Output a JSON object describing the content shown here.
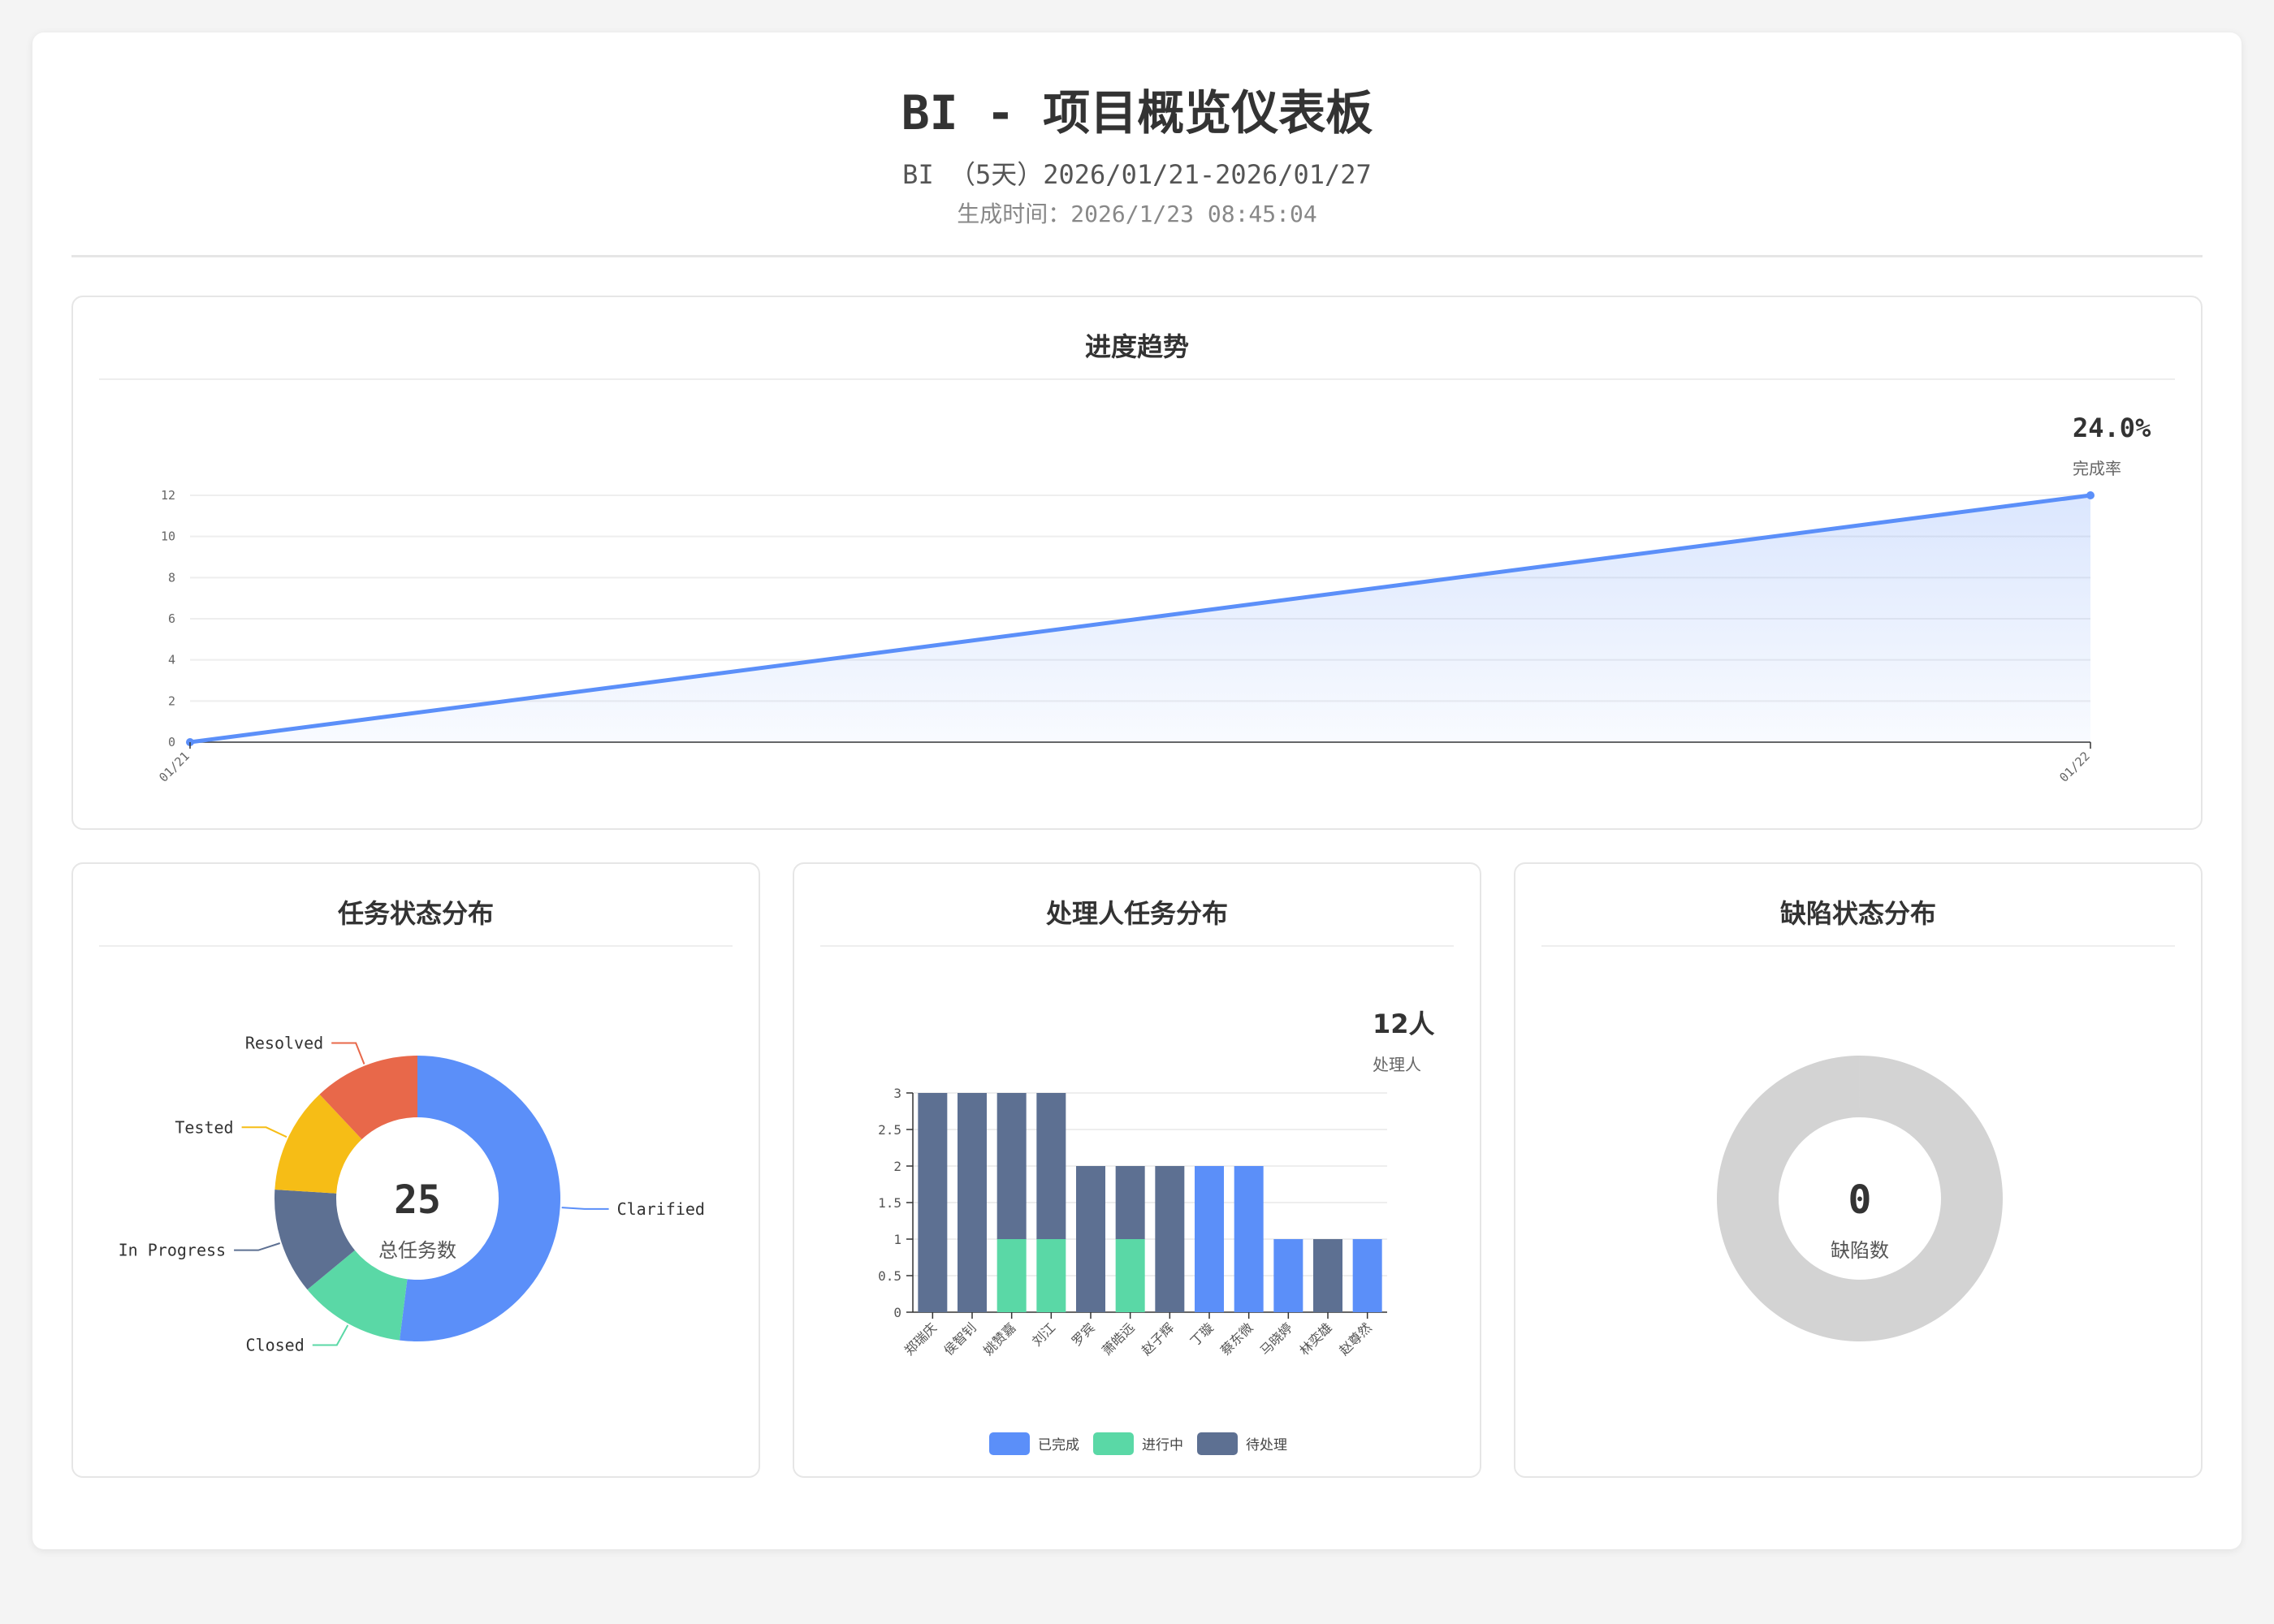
{
  "header": {
    "title": "BI - 项目概览仪表板",
    "subtitle": "BI （5天）2026/01/21-2026/01/27",
    "generated": "生成时间：2026/1/23 08:45:04"
  },
  "progress": {
    "card_title": "进度趋势",
    "kpi_value": "24.0%",
    "kpi_label": "完成率",
    "chart_data": {
      "type": "area",
      "x": [
        "01/21",
        "01/22"
      ],
      "series": [
        {
          "values": [
            0,
            12
          ]
        }
      ],
      "yticks": [
        0,
        2,
        4,
        6,
        8,
        10,
        12
      ],
      "ylim": [
        0,
        12
      ],
      "grid": true,
      "color": "#5b8ff9"
    }
  },
  "task_status": {
    "card_title": "任务状态分布",
    "center_value": "25",
    "center_label": "总任务数",
    "chart_data": {
      "type": "pie",
      "categories": [
        "Clarified",
        "Closed",
        "In Progress",
        "Tested",
        "Resolved"
      ],
      "values": [
        13,
        3,
        3,
        3,
        3
      ],
      "colors": [
        "#5b8ff9",
        "#5ad8a6",
        "#5d7092",
        "#f6bd16",
        "#e8684a"
      ]
    }
  },
  "assignee": {
    "card_title": "处理人任务分布",
    "kpi_value": "12人",
    "kpi_label": "处理人",
    "chart_data": {
      "type": "bar",
      "stacked": true,
      "categories": [
        "郑瑞庆",
        "侯智钊",
        "姚赞嘉",
        "刘江",
        "罗宾",
        "萧皓远",
        "赵子辉",
        "丁璇",
        "蔡东微",
        "马晓婷",
        "林奕雄",
        "赵尊然"
      ],
      "series": [
        {
          "name": "已完成",
          "values": [
            0,
            0,
            0,
            0,
            0,
            0,
            0,
            2,
            2,
            1,
            0,
            1
          ],
          "color": "#5b8ff9"
        },
        {
          "name": "进行中",
          "values": [
            0,
            0,
            1,
            1,
            0,
            1,
            0,
            0,
            0,
            0,
            0,
            0
          ],
          "color": "#5ad8a6"
        },
        {
          "name": "待处理",
          "values": [
            3,
            3,
            2,
            2,
            2,
            1,
            2,
            0,
            0,
            0,
            1,
            0
          ],
          "color": "#5d7092"
        }
      ],
      "yticks": [
        0,
        0.5,
        1,
        1.5,
        2,
        2.5,
        3
      ],
      "ylim": [
        0,
        3
      ],
      "legend": "bottom"
    }
  },
  "defects": {
    "card_title": "缺陷状态分布",
    "center_value": "0",
    "center_label": "缺陷数",
    "chart_data": {
      "type": "pie",
      "categories": [],
      "values": [],
      "empty_color": "#d3d3d3"
    }
  }
}
